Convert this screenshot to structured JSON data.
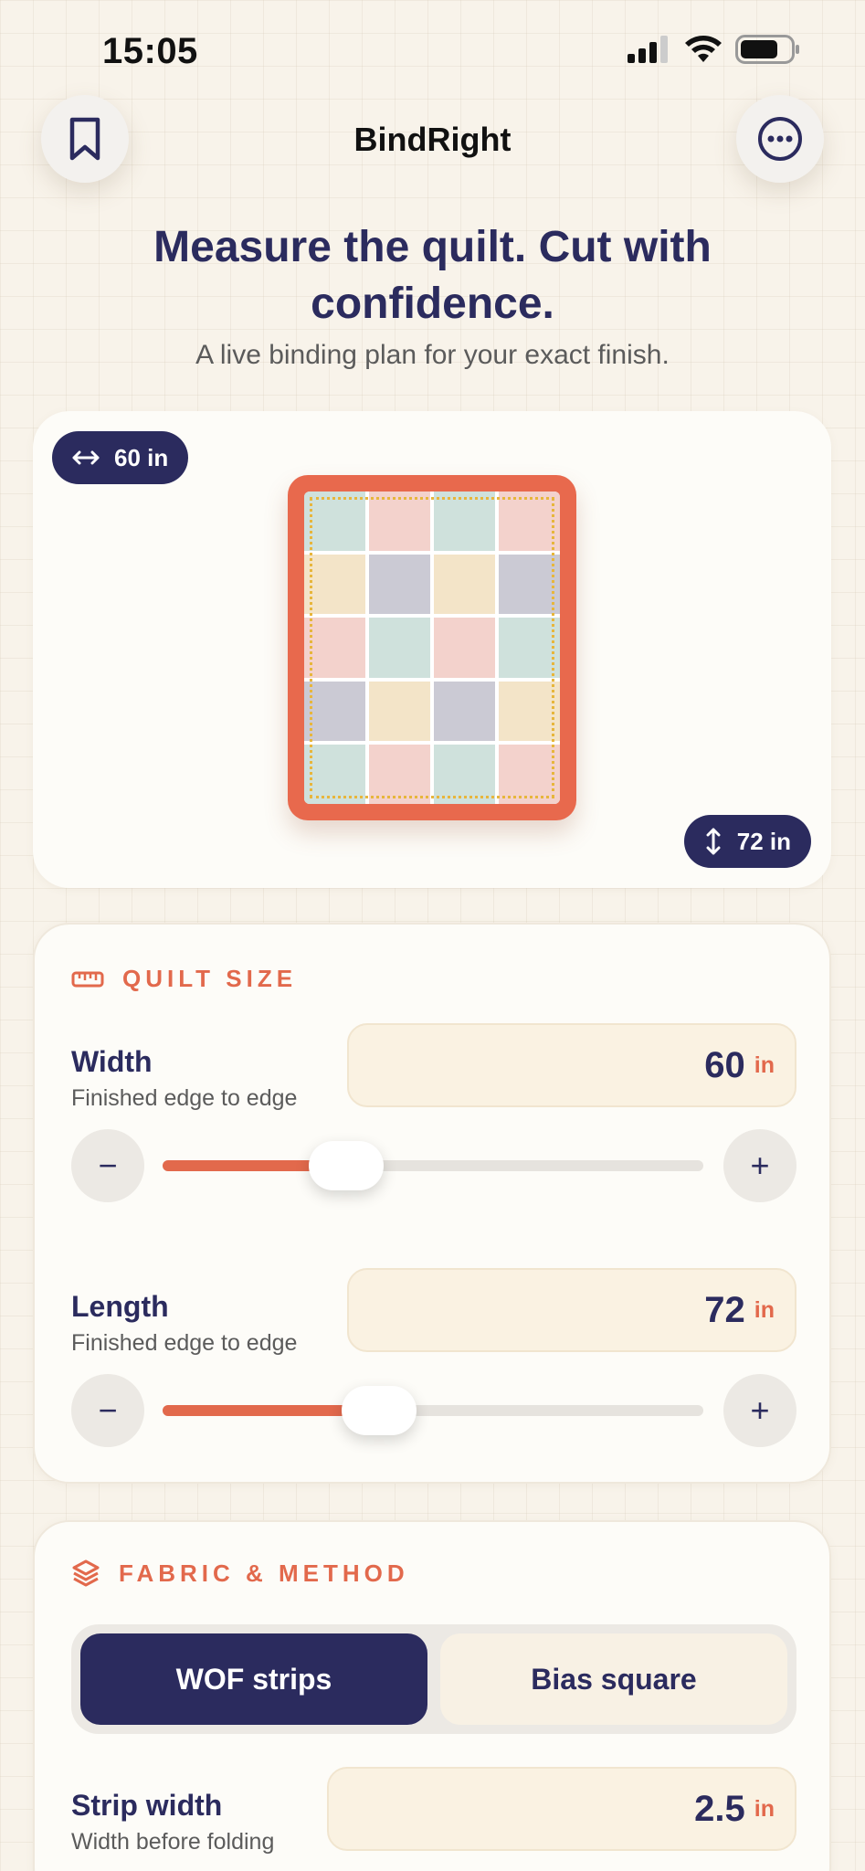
{
  "status": {
    "time": "15:05"
  },
  "app": {
    "title": "BindRight"
  },
  "hero": {
    "headline": "Measure the quilt. Cut with confidence.",
    "subline": "A live binding plan for your exact finish."
  },
  "preview": {
    "width_badge": "60 in",
    "length_badge": "72 in",
    "colors": {
      "binding": "#e8694d",
      "dash": "#e7b63c"
    }
  },
  "quilt_size": {
    "section_title": "QUILT SIZE",
    "width": {
      "label": "Width",
      "sub": "Finished edge to edge",
      "value": "60",
      "unit": "in",
      "slider_fraction": 0.34
    },
    "length": {
      "label": "Length",
      "sub": "Finished edge to edge",
      "value": "72",
      "unit": "in",
      "slider_fraction": 0.4
    },
    "minus": "−",
    "plus": "+"
  },
  "fabric": {
    "section_title": "FABRIC & METHOD",
    "methods": [
      "WOF strips",
      "Bias square"
    ],
    "selected": "WOF strips",
    "strip_width": {
      "label": "Strip width",
      "sub": "Width before folding",
      "value": "2.5",
      "unit": "in"
    }
  },
  "colors": {
    "navy": "#2b2b5e",
    "accent": "#e2694c",
    "background": "#f8f3ea"
  }
}
